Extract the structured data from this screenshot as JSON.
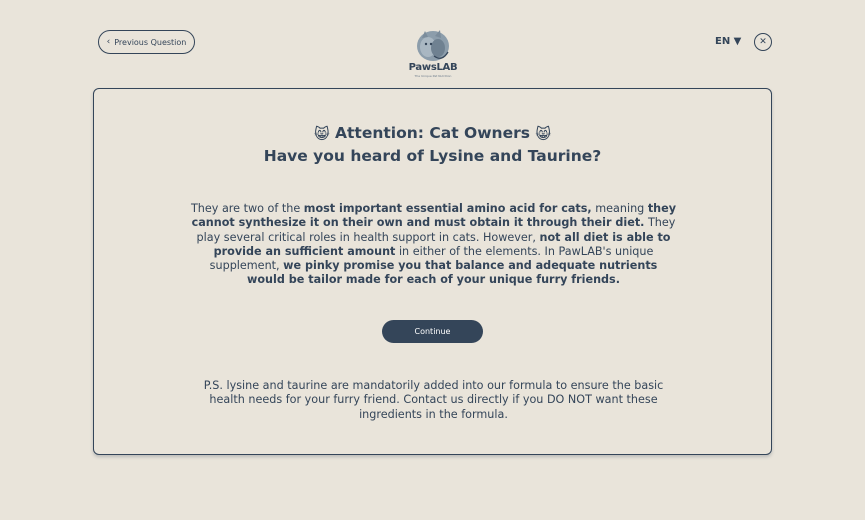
{
  "header": {
    "previous_label": "Previous Question",
    "logo_name": "PawsLAB",
    "logo_tagline": "The Unique Pet Nutrition",
    "language": "EN ▼",
    "close_symbol": "✕"
  },
  "card": {
    "title_line1": "Attention: Cat Owners",
    "title_icon": "😸",
    "title_line2": "Have you heard of Lysine and Taurine?",
    "body": [
      {
        "t": "They are two of the ",
        "b": false
      },
      {
        "t": "most important essential amino acid for cats,",
        "b": true
      },
      {
        "t": " meaning ",
        "b": false
      },
      {
        "t": "they cannot synthesize it on their own and must obtain it through their diet.",
        "b": true
      },
      {
        "t": " They play several critical roles in health support in cats. However, ",
        "b": false
      },
      {
        "t": "not all diet is able to provide an sufficient amount",
        "b": true
      },
      {
        "t": " in either of the elements. In PawLAB's unique supplement, ",
        "b": false
      },
      {
        "t": "we pinky promise you that balance and adequate nutrients would be tailor made for each of your unique furry friends.",
        "b": true
      }
    ],
    "continue_label": "Continue",
    "ps_text": "P.S. lysine and taurine are mandatorily added into our formula to ensure the basic health needs for your furry friend. Contact us directly if you DO NOT want these ingredients in the formula."
  },
  "colors": {
    "background": "#e9e4da",
    "primary": "#344559"
  },
  "icons": {
    "back": "chevron-left-icon",
    "close": "close-icon",
    "title": "cat-face-icon"
  }
}
